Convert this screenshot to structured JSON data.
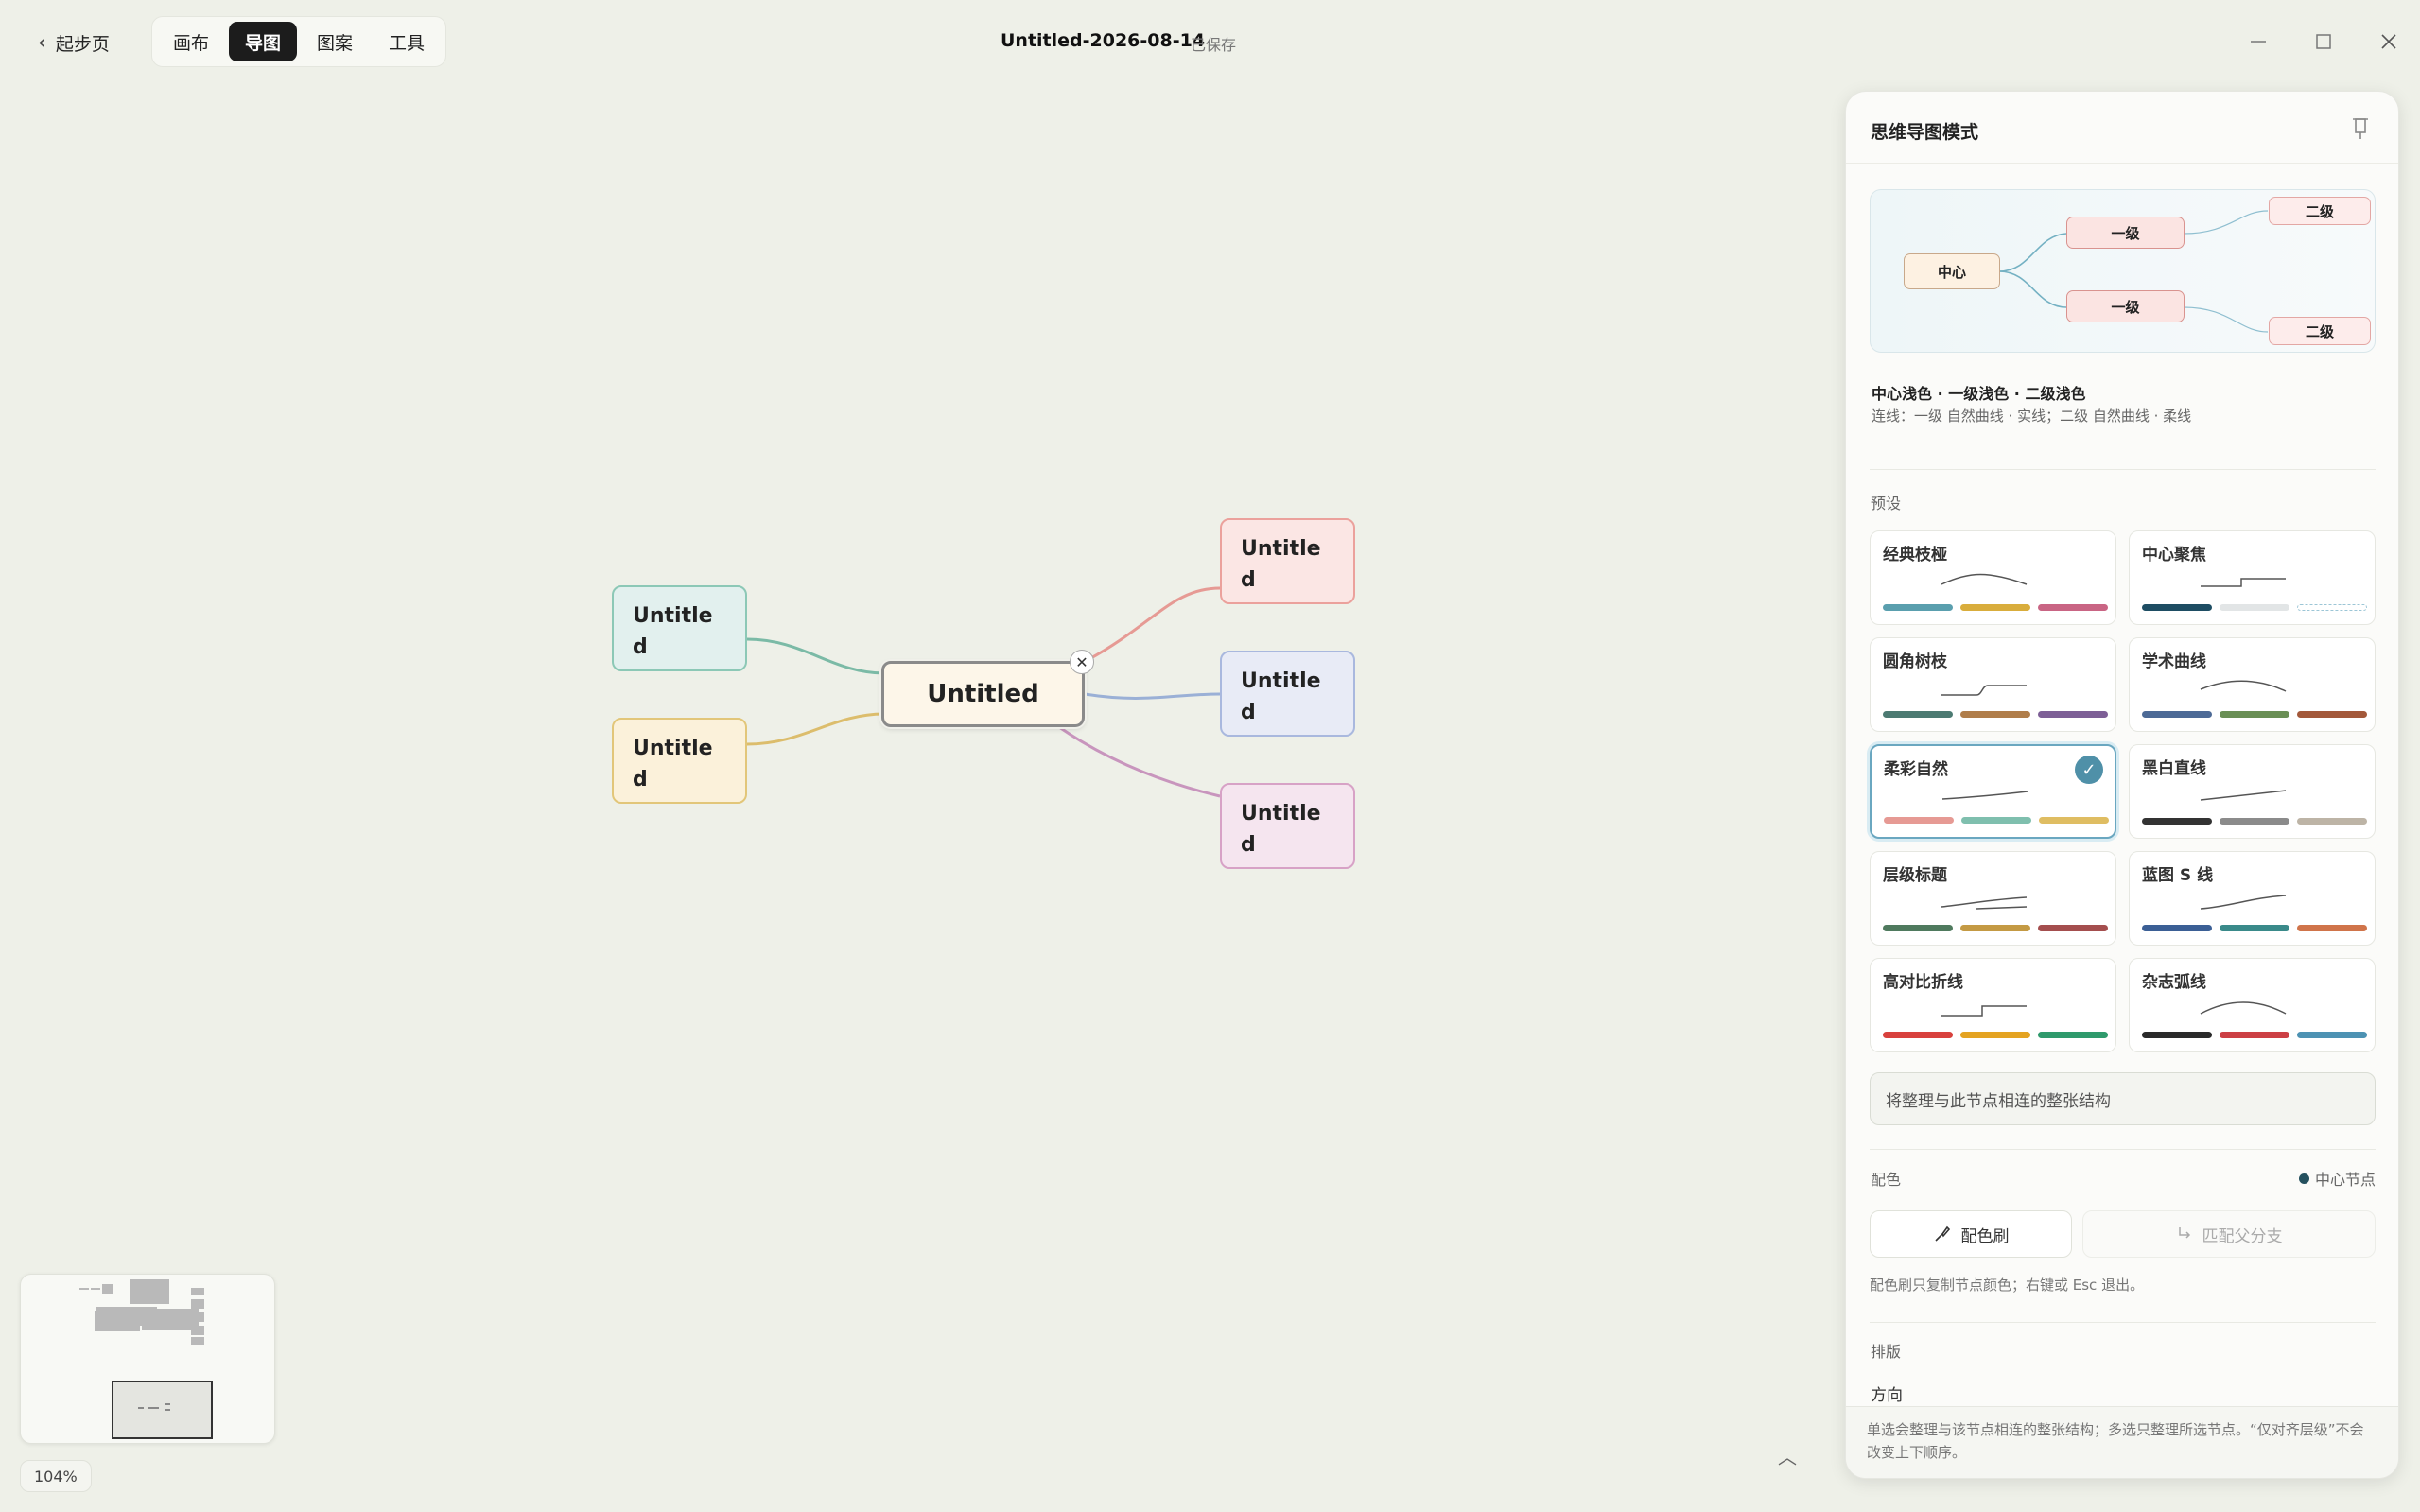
{
  "topbar": {
    "back_label": "起步页",
    "tabs": [
      "画布",
      "导图",
      "图案",
      "工具"
    ],
    "active_tab": "导图",
    "doc_title": "Untitled-2026-08-14",
    "save_status": "已保存"
  },
  "mindmap": {
    "center": "Untitled",
    "left_children": [
      "Untitle d",
      "Untitle d"
    ],
    "right_children": [
      "Untitle d",
      "Untitle d",
      "Untitle d"
    ]
  },
  "zoom": "104%",
  "panel": {
    "title": "思维导图模式",
    "preview": {
      "center": "中心",
      "level1": [
        "一级",
        "一级"
      ],
      "level2": [
        "二级",
        "二级"
      ]
    },
    "summary_title": "中心浅色 · 一级浅色 · 二级浅色",
    "summary_line": "连线：一级 自然曲线 · 实线；二级 自然曲线 · 柔线",
    "presets_label": "预设",
    "presets": [
      {
        "name": "经典枝桠",
        "colors": [
          "#5a9fae",
          "#d9ad3c",
          "#c96584"
        ]
      },
      {
        "name": "中心聚焦",
        "colors": [
          "#1e4d63",
          "#e2e5e6",
          "#ffffff"
        ]
      },
      {
        "name": "圆角树枝",
        "colors": [
          "#4c7a72",
          "#b07d4a",
          "#7d5f96"
        ]
      },
      {
        "name": "学术曲线",
        "colors": [
          "#4d6a96",
          "#6a8f55",
          "#a3583a"
        ]
      },
      {
        "name": "柔彩自然",
        "colors": [
          "#e69a94",
          "#7fbfae",
          "#dfbd62"
        ],
        "selected": true
      },
      {
        "name": "黑白直线",
        "colors": [
          "#333333",
          "#8b8b8b",
          "#bdb4a6"
        ]
      },
      {
        "name": "层级标题",
        "colors": [
          "#4f7a5e",
          "#c49a44",
          "#a44e4e"
        ]
      },
      {
        "name": "蓝图 S 线",
        "colors": [
          "#3b5f95",
          "#3a8a8a",
          "#d0744a"
        ]
      },
      {
        "name": "高对比折线",
        "colors": [
          "#d8413d",
          "#e4a321",
          "#2f9a6c"
        ]
      },
      {
        "name": "杂志弧线",
        "colors": [
          "#2a2a2a",
          "#cc3f44",
          "#4d92b3"
        ]
      }
    ],
    "reorg_label": "将整理与此节点相连的整张结构",
    "color_section": "配色",
    "center_tag": "中心节点",
    "brush_label": "配色刷",
    "match_label": "匹配父分支",
    "brush_hint": "配色刷只复制节点颜色；右键或 Esc 退出。",
    "layout_section": "排版",
    "direction_label": "方向",
    "bottom_note": "单选会整理与该节点相连的整张结构；多选只整理所选节点。“仅对齐层级”不会改变上下顺序。"
  }
}
